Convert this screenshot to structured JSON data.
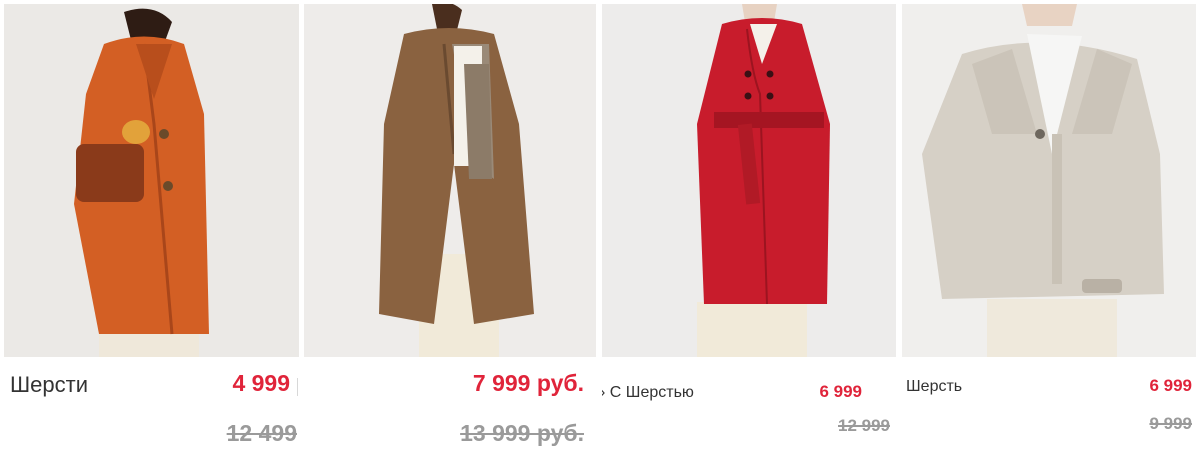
{
  "products": [
    {
      "title": "Шерсти",
      "price": "4 999",
      "old_price": "12 499"
    },
    {
      "title": "",
      "price": "7 999 руб.",
      "old_price": "13 999 руб."
    },
    {
      "title": "› С Шерстью",
      "price": "6 999",
      "old_price": "12 999"
    },
    {
      "title": "Шерсть",
      "price": "6 999",
      "old_price": "9 999"
    }
  ],
  "colors": {
    "sale_price": "#e0243a",
    "old_price": "#9a9a9a",
    "title": "#333333"
  }
}
